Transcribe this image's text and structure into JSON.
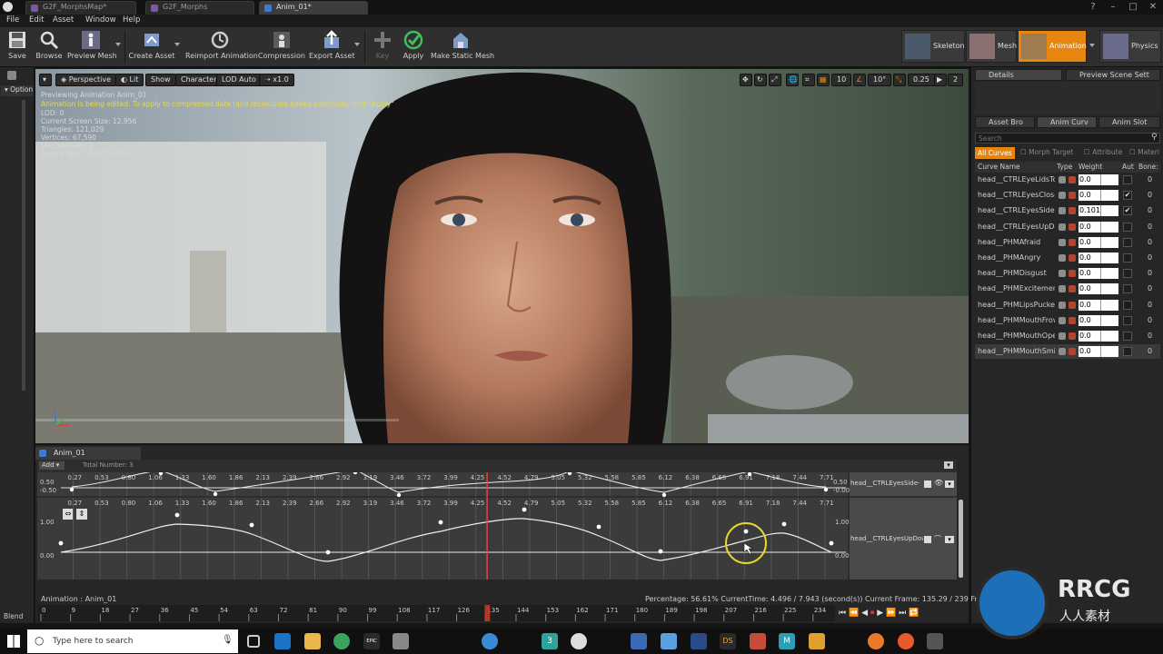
{
  "titlebar": {
    "tabs": [
      {
        "label": "G2F_MorphsMap*",
        "active": false
      },
      {
        "label": "G2F_Morphs",
        "active": false
      },
      {
        "label": "Anim_01*",
        "active": true
      }
    ]
  },
  "menu": [
    "File",
    "Edit",
    "Asset",
    "Window",
    "Help"
  ],
  "toolbar": {
    "save": "Save",
    "browse": "Browse",
    "preview_mesh": "Preview Mesh",
    "create_asset": "Create Asset",
    "reimport": "Reimport Animation",
    "compression": "Compression",
    "export": "Export Asset",
    "key": "Key",
    "apply": "Apply",
    "make_static": "Make Static Mesh"
  },
  "modes": [
    {
      "label": "Skeleton",
      "active": false
    },
    {
      "label": "Mesh",
      "active": false
    },
    {
      "label": "Animation",
      "active": true
    },
    {
      "label": "Physics",
      "active": false
    }
  ],
  "left_strip": {
    "top": "Option",
    "bottom": "Blend"
  },
  "viewport": {
    "perspective": "Perspective",
    "lit": "Lit",
    "show": "Show",
    "character": "Character",
    "lod": "LOD Auto",
    "speed": "x1.0",
    "grid": "10",
    "angle": "10°",
    "scale": "0.25",
    "cams": "2",
    "stats": [
      "Previewing Animation Anim_01",
      "LOD: 0",
      "Current Screen Size: 12.956",
      "Triangles: 121,029",
      "Vertices: 67,590",
      "UV Channels: 1",
      "Approx Size: 317x71x280"
    ],
    "warning": "Animation is being edited. To apply to compressed data (and recalculate baked additives), click \"Apply\""
  },
  "right_panel": {
    "tabs_top": [
      "Details",
      "Preview Scene Sett"
    ],
    "tabs_mid": [
      "Asset Bro",
      "Anim Curv",
      "Anim Slot"
    ],
    "search_placeholder": "Search",
    "filters": {
      "all": "All Curves",
      "morph": "Morph Target",
      "attribute": "Attribute",
      "material": "Materi"
    },
    "headers": {
      "name": "Curve Name",
      "type": "Type",
      "weight": "Weight",
      "auto": "Aut",
      "bone": "Bone:"
    },
    "curves": [
      {
        "name": "head__CTRLEyeLidsTo",
        "weight": "0.0",
        "auto": "",
        "bone": "0"
      },
      {
        "name": "head__CTRLEyesClose",
        "weight": "0.0",
        "auto": "✔",
        "bone": "0"
      },
      {
        "name": "head__CTRLEyesSide-S",
        "weight": "0.101014",
        "auto": "✔",
        "bone": "0"
      },
      {
        "name": "head__CTRLEyesUpDov",
        "weight": "0.0",
        "auto": "",
        "bone": "0"
      },
      {
        "name": "head__PHMAfraid",
        "weight": "0.0",
        "auto": "",
        "bone": "0"
      },
      {
        "name": "head__PHMAngry",
        "weight": "0.0",
        "auto": "",
        "bone": "0"
      },
      {
        "name": "head__PHMDisgust",
        "weight": "0.0",
        "auto": "",
        "bone": "0"
      },
      {
        "name": "head__PHMExcitement",
        "weight": "0.0",
        "auto": "",
        "bone": "0"
      },
      {
        "name": "head__PHMLipsPucker",
        "weight": "0.0",
        "auto": "",
        "bone": "0"
      },
      {
        "name": "head__PHMMouthFrow",
        "weight": "0.0",
        "auto": "",
        "bone": "0"
      },
      {
        "name": "head__PHMMouthOper",
        "weight": "0.0",
        "auto": "",
        "bone": "0"
      },
      {
        "name": "head__PHMMouthSmile",
        "weight": "0.0",
        "auto": "",
        "bone": "0"
      }
    ]
  },
  "lower": {
    "tab": "Anim_01",
    "add": "Add",
    "total": "Total Number: 3",
    "track1_name": "head__CTRLEyesSide-S",
    "track2_name": "head__CTRLEyesUpDow",
    "track1_hi": "0.50",
    "track1_lo": "-0.50",
    "track1_r_hi": "0.50",
    "track1_r_lo": "-0.00",
    "track2_hi": "1.00",
    "track2_lo": "0.00",
    "ruler": [
      "0.27",
      "0.53",
      "0.80",
      "1.06",
      "1.33",
      "1.60",
      "1.86",
      "2.13",
      "2.39",
      "2.66",
      "2.92",
      "3.19",
      "3.46",
      "3.72",
      "3.99",
      "4.25",
      "4.52",
      "4.79",
      "5.05",
      "5.32",
      "5.58",
      "5.85",
      "6.12",
      "6.38",
      "6.65",
      "6.91",
      "7.18",
      "7.44",
      "7.71"
    ],
    "anim_label": "Animation : Anim_01",
    "status": "Percentage: 56.61% CurrentTime: 4.496 / 7.943 (second(s)) Current Frame: 135.29 / 239 Frame",
    "frames": [
      "0",
      "9",
      "18",
      "27",
      "36",
      "45",
      "54",
      "63",
      "72",
      "81",
      "90",
      "99",
      "108",
      "117",
      "126",
      "135",
      "144",
      "153",
      "162",
      "171",
      "180",
      "189",
      "198",
      "207",
      "216",
      "225",
      "234"
    ],
    "playhead_fraction": 0.5661
  },
  "taskbar": {
    "search_placeholder": "Type here to search",
    "icon_ds": "DS",
    "icon_m": "M",
    "icon_epic": "EPIC",
    "icon_3": "3",
    "right_logo": "RRCG",
    "right_logo_sub": "人人素材"
  }
}
